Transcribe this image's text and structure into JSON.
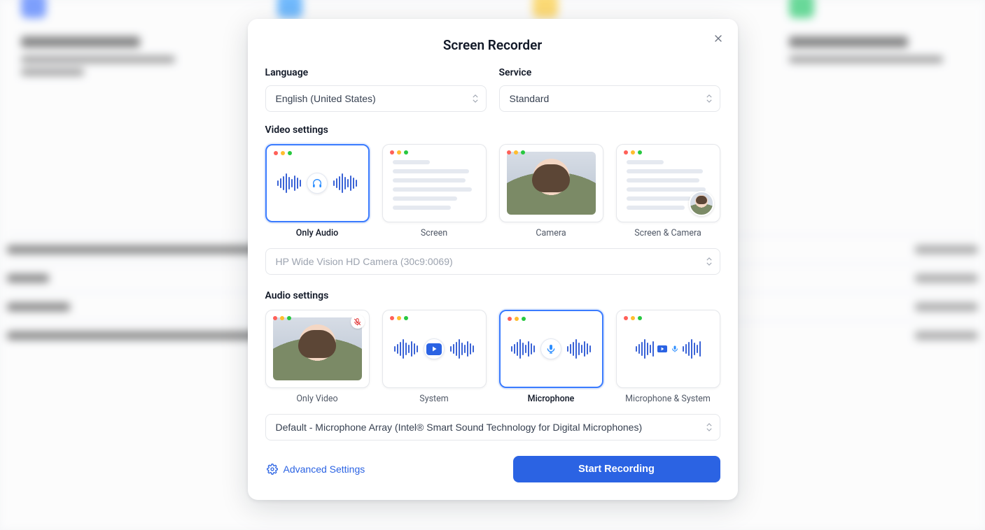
{
  "modal": {
    "title": "Screen Recorder",
    "language": {
      "label": "Language",
      "value": "English (United States)"
    },
    "service": {
      "label": "Service",
      "value": "Standard"
    },
    "video": {
      "section_label": "Video settings",
      "options": {
        "only_audio": "Only Audio",
        "screen": "Screen",
        "camera": "Camera",
        "screen_camera": "Screen & Camera"
      },
      "camera_device": "HP Wide Vision HD Camera (30c9:0069)"
    },
    "audio": {
      "section_label": "Audio settings",
      "options": {
        "only_video": "Only Video",
        "system": "System",
        "microphone": "Microphone",
        "mic_system": "Microphone & System"
      },
      "mic_device": "Default - Microphone Array (Intel® Smart Sound Technology for Digital Microphones)"
    },
    "advanced_label": "Advanced Settings",
    "start_label": "Start Recording"
  }
}
